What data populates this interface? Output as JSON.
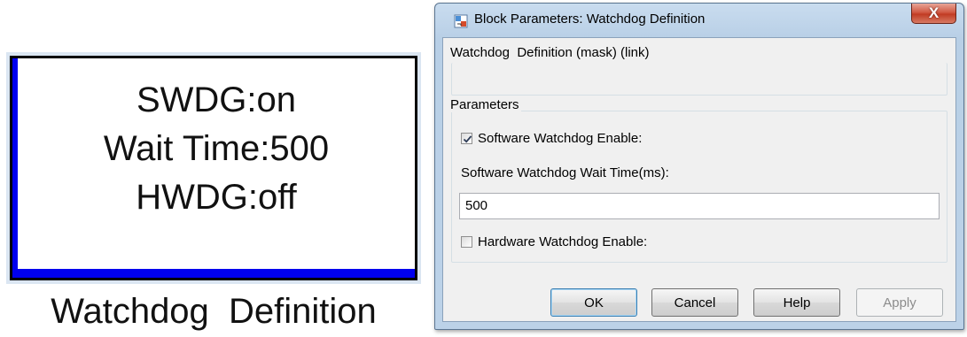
{
  "block": {
    "lines": [
      "SWDG:on",
      "Wait Time:500",
      "HWDG:off"
    ],
    "caption": "Watchdog  Definition"
  },
  "dialog": {
    "title": "Block Parameters: Watchdog Definition",
    "close_label": "X",
    "description": "Watchdog  Definition (mask) (link)",
    "parameters_label": "Parameters",
    "software_enable": {
      "label": "Software Watchdog Enable:",
      "checked": true
    },
    "wait_time": {
      "label": "Software Watchdog Wait Time(ms):",
      "value": "500"
    },
    "hardware_enable": {
      "label": "Hardware Watchdog Enable:",
      "checked": false
    },
    "buttons": {
      "ok": "OK",
      "cancel": "Cancel",
      "help": "Help",
      "apply": "Apply"
    }
  },
  "colors": {
    "block_shadow": "#0000ee",
    "close_button": "#c13c24",
    "window_frame": "#b8cfe6"
  },
  "icons": [
    "simulink-block-icon",
    "close-icon",
    "checkmark-icon"
  ]
}
